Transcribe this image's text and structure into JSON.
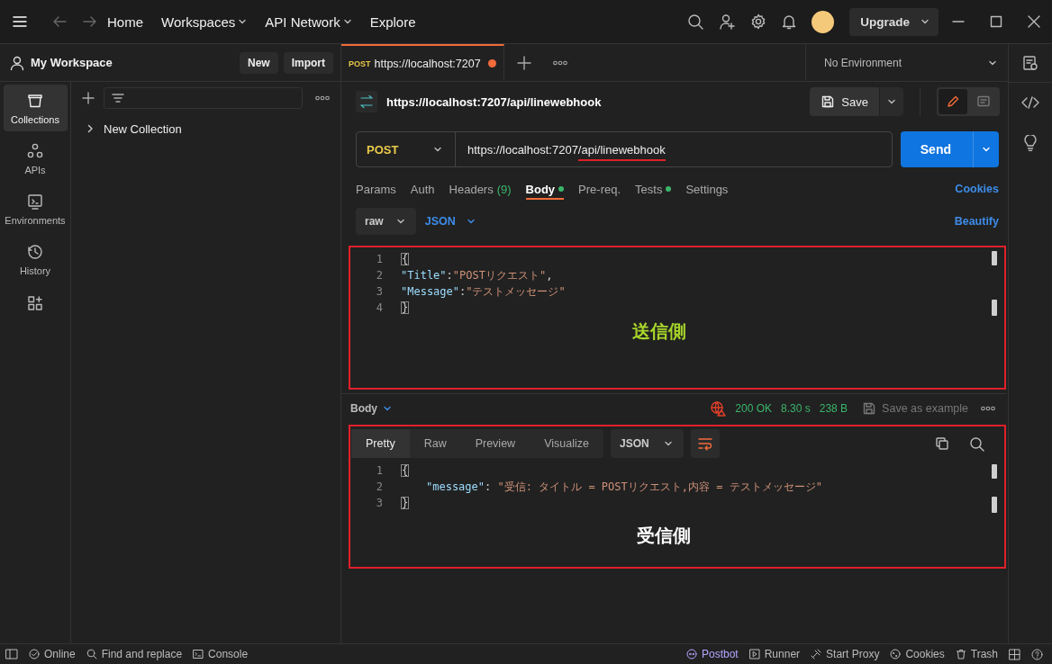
{
  "titlebar": {
    "nav": [
      {
        "label": "Home",
        "has_menu": false
      },
      {
        "label": "Workspaces",
        "has_menu": true
      },
      {
        "label": "API Network",
        "has_menu": true
      },
      {
        "label": "Explore",
        "has_menu": false
      }
    ],
    "upgrade_button": "Upgrade"
  },
  "workspace": {
    "name": "My Workspace",
    "buttons": [
      "New",
      "Import"
    ]
  },
  "sidebar": {
    "items": [
      {
        "label": "Collections",
        "selected": true
      },
      {
        "label": "APIs",
        "selected": false
      },
      {
        "label": "Environments",
        "selected": false
      },
      {
        "label": "History",
        "selected": false
      }
    ]
  },
  "collections": [
    {
      "name": "New Collection",
      "expanded": false
    }
  ],
  "request_tabs": [
    {
      "method": "POST",
      "title": "https://localhost:7207",
      "unsaved": true,
      "selected": true
    }
  ],
  "environment": "No Environment",
  "request": {
    "title": "https://localhost:7207/api/linewebhook",
    "save_button": "Save",
    "method": "POST",
    "url": [
      {
        "text": "https://localhost:7207",
        "underlined": false
      },
      {
        "text": "/api/linewebhook",
        "underlined": true
      }
    ],
    "send_button": "Send",
    "tabs": [
      {
        "label": "Params",
        "selected": false,
        "dot": false
      },
      {
        "label": "Auth",
        "selected": false,
        "dot": false
      },
      {
        "label": "Headers",
        "count": "(9)",
        "selected": false,
        "dot": false
      },
      {
        "label": "Body",
        "selected": true,
        "dot": true
      },
      {
        "label": "Pre-req.",
        "selected": false,
        "dot": false
      },
      {
        "label": "Tests",
        "selected": false,
        "dot": true
      },
      {
        "label": "Settings",
        "selected": false,
        "dot": false
      }
    ],
    "cookies_link": "Cookies",
    "body_mode": "raw",
    "body_language": "JSON",
    "beautify_link": "Beautify",
    "body_lines": [
      {
        "number": "1",
        "indented": false,
        "tokens": [
          {
            "kind": "bracket",
            "text": "{"
          }
        ]
      },
      {
        "number": "2",
        "indented": false,
        "tokens": [
          {
            "kind": "key",
            "text": "\"Title\""
          },
          {
            "kind": "punct",
            "text": ":"
          },
          {
            "kind": "string",
            "text": "\"POSTリクエスト\""
          },
          {
            "kind": "punct",
            "text": ","
          }
        ]
      },
      {
        "number": "3",
        "indented": false,
        "tokens": [
          {
            "kind": "key",
            "text": "\"Message\""
          },
          {
            "kind": "punct",
            "text": ":"
          },
          {
            "kind": "string",
            "text": "\"テストメッセージ\""
          }
        ]
      },
      {
        "number": "4",
        "indented": false,
        "tokens": [
          {
            "kind": "bracket",
            "text": "}"
          }
        ]
      }
    ],
    "annotation": "送信側"
  },
  "response": {
    "label": "Body",
    "status": "200 OK",
    "time": "8.30 s",
    "size": "238 B",
    "save_example": "Save as example",
    "tabs": [
      {
        "label": "Pretty",
        "selected": true
      },
      {
        "label": "Raw",
        "selected": false
      },
      {
        "label": "Preview",
        "selected": false
      },
      {
        "label": "Visualize",
        "selected": false
      }
    ],
    "language": "JSON",
    "lines": [
      {
        "number": "1",
        "indented": false,
        "tokens": [
          {
            "kind": "bracket",
            "text": "{"
          }
        ]
      },
      {
        "number": "2",
        "indented": true,
        "tokens": [
          {
            "kind": "key",
            "text": "\"message\""
          },
          {
            "kind": "punct",
            "text": ": "
          },
          {
            "kind": "string",
            "text": "\"受信: タイトル = POSTリクエスト,内容 = テストメッセージ\""
          }
        ]
      },
      {
        "number": "3",
        "indented": false,
        "tokens": [
          {
            "kind": "bracket",
            "text": "}"
          }
        ]
      }
    ],
    "annotation": "受信側"
  },
  "status_bar": {
    "left": [
      "Online",
      "Find and replace",
      "Console"
    ],
    "right": [
      "Postbot",
      "Runner",
      "Start Proxy",
      "Cookies",
      "Trash"
    ]
  }
}
